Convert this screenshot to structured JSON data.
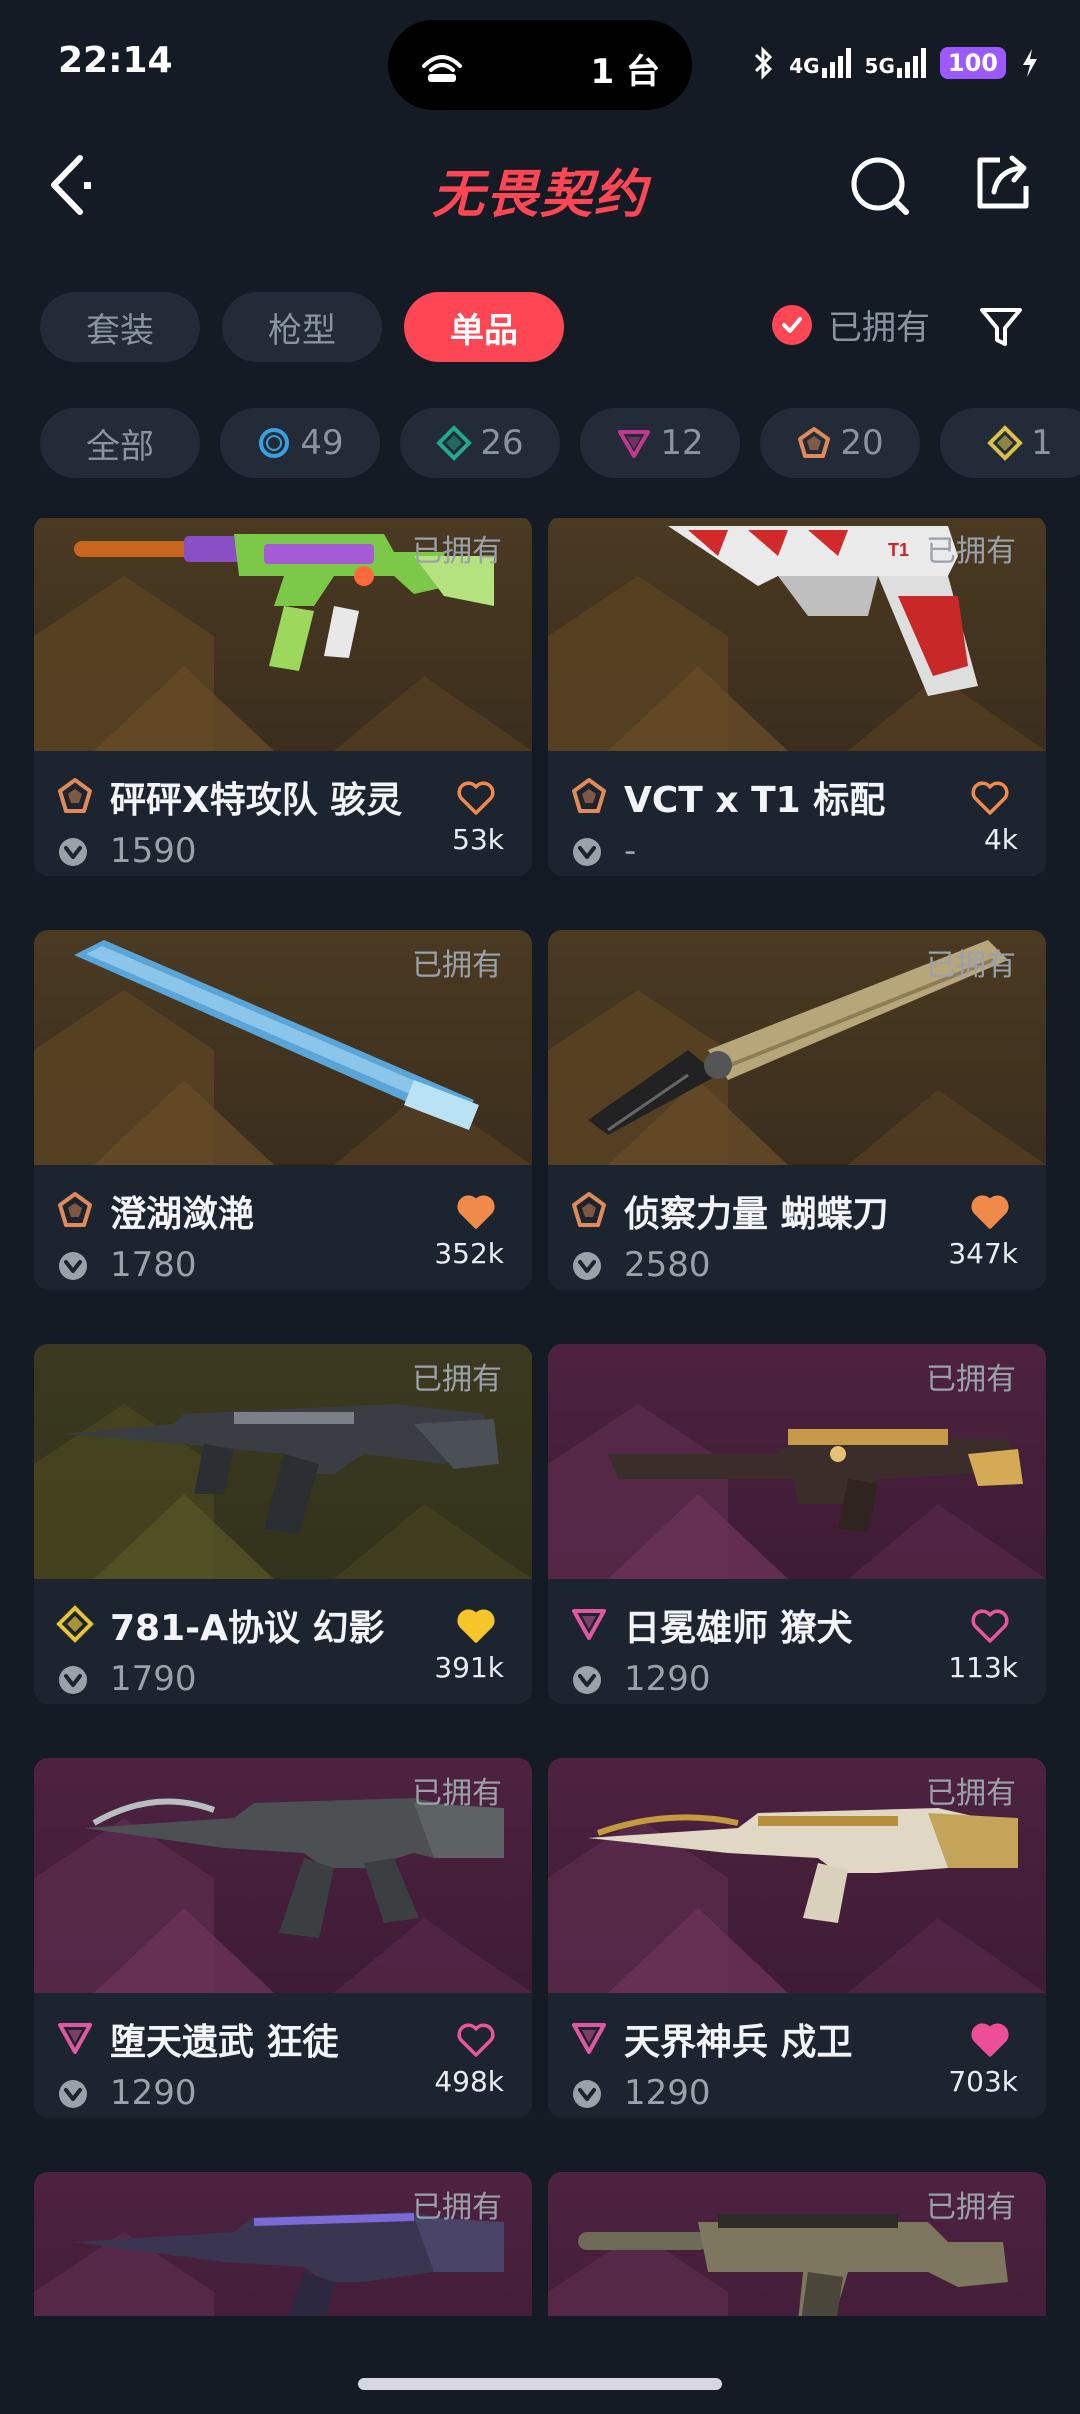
{
  "status_bar": {
    "time": "22:14",
    "island_text": "1 台",
    "net1": "4G",
    "net2": "5G",
    "battery": "100"
  },
  "header": {
    "title": "无畏契约"
  },
  "tabs": [
    {
      "label": "套装",
      "active": false
    },
    {
      "label": "枪型",
      "active": false
    },
    {
      "label": "单品",
      "active": true
    }
  ],
  "owned_filter": {
    "label": "已拥有",
    "checked": true
  },
  "chips": [
    {
      "label": "全部",
      "icon": ""
    },
    {
      "label": "49",
      "icon": "select-tier-icon",
      "color": "#3aa0e0"
    },
    {
      "label": "26",
      "icon": "deluxe-tier-icon",
      "color": "#21a88e"
    },
    {
      "label": "12",
      "icon": "premium-tier-icon",
      "color": "#c2388f"
    },
    {
      "label": "20",
      "icon": "exclusive-tier-icon",
      "color": "#e08a5a"
    },
    {
      "label": "1",
      "icon": "ultra-tier-icon",
      "color": "#d8c24a"
    }
  ],
  "owned_tag": "已拥有",
  "cards": [
    {
      "name": "砰砰X特攻队 骇灵",
      "price": "1590",
      "likes": "53k",
      "tier": "exclusive",
      "tier_color": "#e08a5a",
      "bg": "gold",
      "liked": false,
      "heart_color": "#f08a4b",
      "weapon": "smg-spectre-toy"
    },
    {
      "name": "VCT x T1 标配",
      "price": "-",
      "likes": "4k",
      "tier": "exclusive",
      "tier_color": "#e08a5a",
      "bg": "gold",
      "liked": false,
      "heart_color": "#f08a4b",
      "weapon": "pistol-classic-t1"
    },
    {
      "name": "澄湖潋滟",
      "price": "1780",
      "likes": "352k",
      "tier": "exclusive",
      "tier_color": "#e08a5a",
      "bg": "gold",
      "liked": true,
      "heart_color": "#f08a4b",
      "weapon": "melee-fan"
    },
    {
      "name": "侦察力量 蝴蝶刀",
      "price": "2580",
      "likes": "347k",
      "tier": "exclusive",
      "tier_color": "#e08a5a",
      "bg": "gold",
      "liked": true,
      "heart_color": "#f08a4b",
      "weapon": "melee-butterfly-knife"
    },
    {
      "name": "781-A协议 幻影",
      "price": "1790",
      "likes": "391k",
      "tier": "ultra",
      "tier_color": "#e5c437",
      "bg": "olive",
      "liked": true,
      "heart_color": "#f5c52a",
      "weapon": "rifle-phantom"
    },
    {
      "name": "日冕雄师 獠犬",
      "price": "1290",
      "likes": "113k",
      "tier": "premium",
      "tier_color": "#e0589f",
      "bg": "purple",
      "liked": false,
      "heart_color": "#e8559c",
      "weapon": "sniper-outlaw"
    },
    {
      "name": "堕天遗武 狂徒",
      "price": "1290",
      "likes": "498k",
      "tier": "premium",
      "tier_color": "#e0589f",
      "bg": "purple",
      "liked": false,
      "heart_color": "#e8559c",
      "weapon": "rifle-vandal-dark"
    },
    {
      "name": "天界神兵 戍卫",
      "price": "1290",
      "likes": "703k",
      "tier": "premium",
      "tier_color": "#e0589f",
      "bg": "purple",
      "liked": true,
      "heart_color": "#ec4f98",
      "weapon": "rifle-guardian-gold"
    },
    {
      "name": "",
      "price": "",
      "likes": "",
      "tier": "premium",
      "tier_color": "#e0589f",
      "bg": "purple",
      "liked": false,
      "heart_color": "#e8559c",
      "weapon": "rifle-vandal-purple"
    },
    {
      "name": "",
      "price": "",
      "likes": "",
      "tier": "premium",
      "tier_color": "#e0589f",
      "bg": "purple",
      "liked": false,
      "heart_color": "#e8559c",
      "weapon": "smg-spectre-tan"
    }
  ]
}
